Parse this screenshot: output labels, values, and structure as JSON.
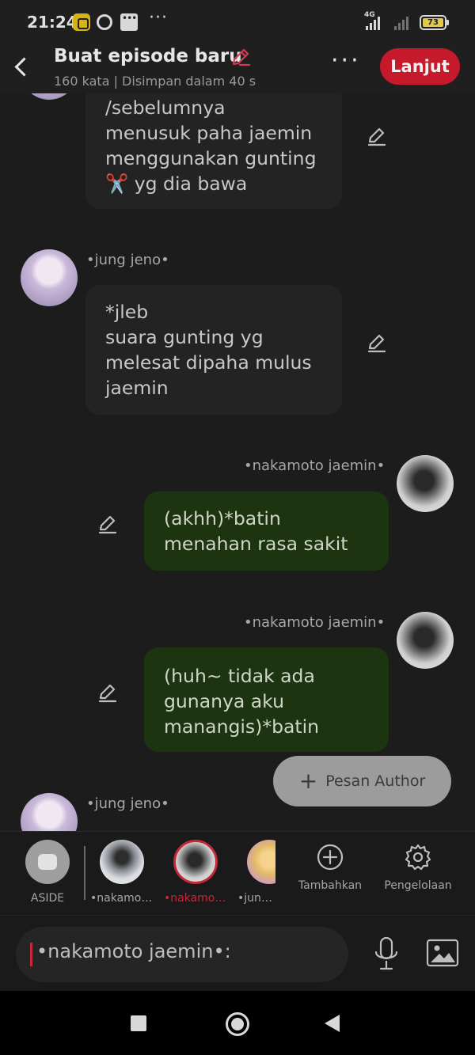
{
  "status_bar": {
    "time": "21:24",
    "network": "4G",
    "battery": "73",
    "more": "···"
  },
  "header": {
    "title": "Buat episode baru",
    "subtitle": "160 kata | Disimpan dalam 40 s",
    "more_icon": "···",
    "continue_label": "Lanjut"
  },
  "messages": [
    {
      "side": "left",
      "text": "/sebelumnya\nmenusuk paha jaemin\nmenggunakan gunting\n✂️ yg dia bawa"
    },
    {
      "side": "left",
      "name": "•jung jeno•",
      "text": "*jleb\nsuara gunting yg\nmelesat dipaha mulus\njaemin"
    },
    {
      "side": "right",
      "name": "•nakamoto jaemin•",
      "text": "(akhh)*batin\nmenahan rasa sakit"
    },
    {
      "side": "right",
      "name": "•nakamoto jaemin•",
      "text": "(huh~ tidak ada\ngunanya aku\nmanangis)*batin"
    },
    {
      "side": "left",
      "name": "•jung jeno•",
      "text": ""
    }
  ],
  "author_button": {
    "icon": "+",
    "label": "Pesan Author"
  },
  "characters": [
    {
      "label": "ASIDE",
      "active": false
    },
    {
      "label": "•nakamoto jaemin•",
      "active": false
    },
    {
      "label": "•nakamoto jaemin•",
      "active": true
    },
    {
      "label": "•jung sh",
      "active": false
    }
  ],
  "tools": {
    "add_label": "Tambahkan",
    "manage_label": "Pengelolaan"
  },
  "input": {
    "value": "•nakamoto jaemin•:"
  },
  "icons": {
    "back": "chevron-left-icon",
    "title_edit": "pencil-icon",
    "add": "plus-circle-icon",
    "manage": "gear-icon",
    "mic": "microphone-icon",
    "image": "image-icon"
  },
  "colors": {
    "accent": "#c41a2b",
    "right_bubble": "#1c3410",
    "left_bubble": "#232323"
  }
}
